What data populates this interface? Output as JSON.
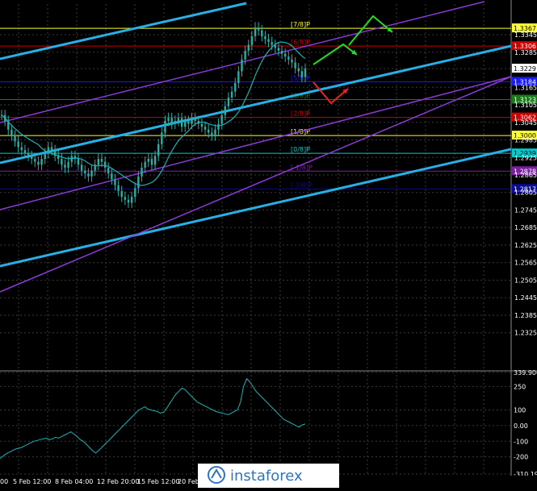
{
  "price_scale": {
    "min": 1.22,
    "max": 1.345,
    "ticks": [
      1.3345,
      1.3285,
      1.3229,
      1.3165,
      1.3105,
      1.3045,
      1.2985,
      1.2925,
      1.2865,
      1.2805,
      1.2745,
      1.2685,
      1.2625,
      1.2565,
      1.2505,
      1.2445,
      1.2385,
      1.2325
    ],
    "tick_labels": [
      "1.3345",
      "1.3285",
      "1.3229",
      "1.3165",
      "1.3105",
      "1.3045",
      "1.2985",
      "1.2925",
      "1.2865",
      "1.2805",
      "1.2745",
      "1.2685",
      "1.2625",
      "1.2565",
      "1.2505",
      "1.2445",
      "1.2385",
      "1.2325"
    ]
  },
  "murrey_levels": [
    {
      "label": "[7/8]P",
      "price": 1.3367,
      "price_label": "1.3367",
      "color": "#ffff33",
      "badge_bg": "#ffff33",
      "badge_fg": "#000000"
    },
    {
      "label": "[6/8]P",
      "price": 1.3306,
      "price_label": "1.3306",
      "color": "#cc0000",
      "badge_bg": "#cc0000",
      "badge_fg": "#ffffff"
    },
    {
      "label": "[5/8]P",
      "price": 1.3184,
      "price_label": "1.3184",
      "color": "#1a1aff",
      "badge_bg": "#1a1aff",
      "badge_fg": "#ffffff"
    },
    {
      "label": "[3/8]P",
      "price": 1.3123,
      "price_label": "1.3123",
      "color": "#1a7a1a",
      "badge_bg": "#1a7a1a",
      "badge_fg": "#ffffff"
    },
    {
      "label": "[2/8]P",
      "price": 1.3062,
      "price_label": "1.3062",
      "color": "#cc0000",
      "badge_bg": "#cc0000",
      "badge_fg": "#ffffff"
    },
    {
      "label": "[1/8]P",
      "price": 1.3,
      "price_label": "1.3000",
      "color": "#ffff33",
      "badge_bg": "#ffff33",
      "badge_fg": "#000000"
    },
    {
      "label": "[0/8]P",
      "price": 1.2939,
      "price_label": "1.2939",
      "color": "#00cccc",
      "badge_bg": "#00cccc",
      "badge_fg": "#000000"
    },
    {
      "label": "[-1/8]P",
      "price": 1.2878,
      "price_label": "1.2878",
      "color": "#7a1fa2",
      "badge_bg": "#7a1fa2",
      "badge_fg": "#ffffff"
    },
    {
      "label": "[-2/8]P",
      "price": 1.2817,
      "price_label": "1.2817",
      "color": "#0a0a9a",
      "badge_bg": "#0a0a9a",
      "badge_fg": "#ffffff"
    }
  ],
  "current_price": {
    "label": "1.3229",
    "price": 1.3229
  },
  "oscillator": {
    "ticks": [
      339.9066,
      250,
      100,
      0.0,
      -100,
      -200,
      -310.194
    ],
    "tick_labels": [
      "339.9066",
      "250",
      "100",
      "0.00",
      "-100",
      "-200",
      "-310.194"
    ],
    "min": -310.194,
    "max": 339.9066,
    "values": [
      -210,
      -195,
      -180,
      -170,
      -160,
      -150,
      -145,
      -140,
      -130,
      -120,
      -110,
      -100,
      -95,
      -90,
      -85,
      -80,
      -90,
      -85,
      -75,
      -80,
      -70,
      -60,
      -50,
      -40,
      -55,
      -70,
      -90,
      -100,
      -120,
      -140,
      -160,
      -175,
      -160,
      -140,
      -120,
      -100,
      -80,
      -60,
      -40,
      -20,
      0,
      20,
      40,
      60,
      80,
      100,
      110,
      120,
      105,
      100,
      95,
      90,
      80,
      85,
      110,
      140,
      170,
      200,
      220,
      240,
      230,
      210,
      190,
      170,
      150,
      140,
      130,
      120,
      110,
      100,
      90,
      85,
      80,
      75,
      70,
      80,
      90,
      100,
      150,
      250,
      300,
      280,
      250,
      220,
      200,
      180,
      160,
      140,
      120,
      100,
      80,
      60,
      40,
      30,
      20,
      10,
      0,
      -10,
      5,
      10
    ]
  },
  "price_series": [
    1.307,
    1.305,
    1.302,
    1.3,
    1.298,
    1.296,
    1.295,
    1.294,
    1.293,
    1.292,
    1.291,
    1.29,
    1.292,
    1.294,
    1.296,
    1.295,
    1.293,
    1.292,
    1.29,
    1.289,
    1.291,
    1.293,
    1.292,
    1.29,
    1.288,
    1.287,
    1.286,
    1.288,
    1.29,
    1.292,
    1.291,
    1.289,
    1.287,
    1.285,
    1.283,
    1.281,
    1.279,
    1.278,
    1.277,
    1.279,
    1.282,
    1.286,
    1.289,
    1.291,
    1.292,
    1.29,
    1.293,
    1.297,
    1.301,
    1.305,
    1.306,
    1.304,
    1.305,
    1.306,
    1.303,
    1.305,
    1.304,
    1.306,
    1.305,
    1.304,
    1.303,
    1.302,
    1.301,
    1.3,
    1.302,
    1.304,
    1.307,
    1.31,
    1.313,
    1.315,
    1.318,
    1.322,
    1.326,
    1.329,
    1.331,
    1.334,
    1.337,
    1.336,
    1.334,
    1.333,
    1.332,
    1.331,
    1.33,
    1.329,
    1.328,
    1.327,
    1.326,
    1.325,
    1.323,
    1.322,
    1.32,
    1.3229
  ],
  "time_axis": {
    "labels": [
      "00",
      "5 Feb 12:00",
      "8 Feb 04:00",
      "12 Feb 20:00",
      "15 Feb 12:00",
      "20 Feb",
      "",
      "",
      "",
      "",
      "",
      ""
    ]
  },
  "watermark": {
    "brand": "instaforex"
  },
  "colors": {
    "background": "#000000",
    "grid": "#3a3a3a",
    "candle": "#2aaea6",
    "ma": "#17b3b3",
    "channel_blue": "#27b0e6",
    "channel_purple": "#8b3ad6",
    "arrow_up": "#22dd22",
    "arrow_down": "#ee2222",
    "axis_text": "#ffffff"
  }
}
